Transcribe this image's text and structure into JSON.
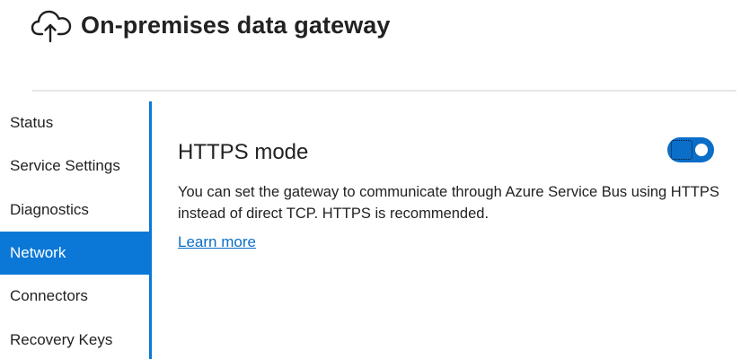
{
  "header": {
    "title": "On-premises data gateway",
    "icon": "cloud-upload-icon"
  },
  "sidebar": {
    "items": [
      {
        "label": "Status",
        "active": false
      },
      {
        "label": "Service Settings",
        "active": false
      },
      {
        "label": "Diagnostics",
        "active": false
      },
      {
        "label": "Network",
        "active": true
      },
      {
        "label": "Connectors",
        "active": false
      },
      {
        "label": "Recovery Keys",
        "active": false
      }
    ]
  },
  "main": {
    "section_title": "HTTPS mode",
    "toggle_state": "on",
    "description": "You can set the gateway to communicate through Azure Service Bus using HTTPS instead of direct TCP. HTTPS is recommended.",
    "learn_more_label": "Learn more"
  },
  "colors": {
    "accent": "#0b78d7",
    "link": "#0b6ec8",
    "divider": "#e6e6e6"
  }
}
